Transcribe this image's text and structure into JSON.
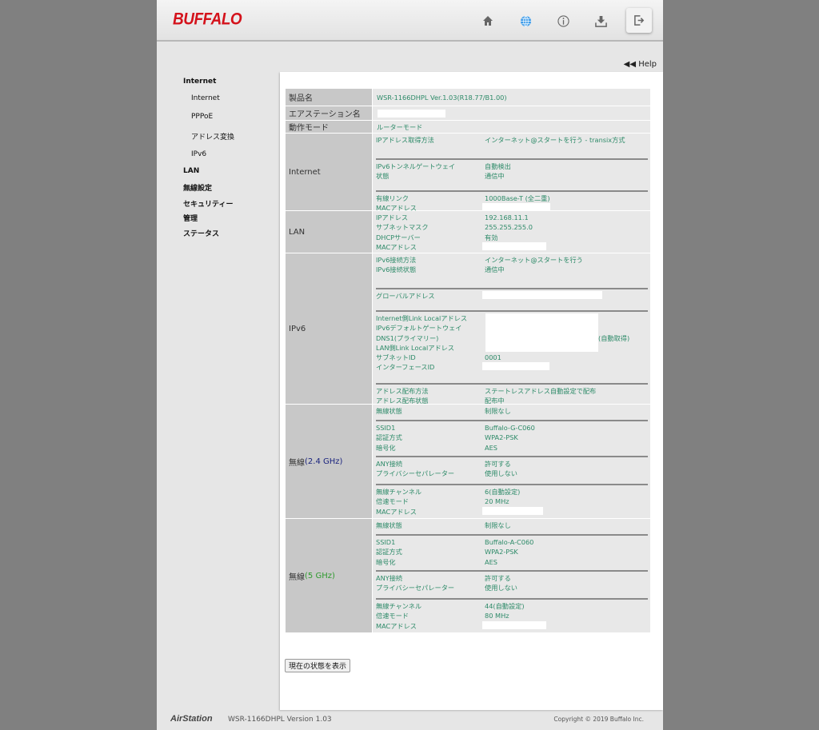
{
  "header": {
    "logo": "BUFFALO",
    "icons": [
      "home-icon",
      "globe-icon",
      "info-icon",
      "download-icon",
      "logout-icon"
    ]
  },
  "help": "◀◀ Help",
  "sidebar": [
    {
      "label": "Internet",
      "level": 0
    },
    {
      "label": "Internet",
      "level": 1
    },
    {
      "label": "PPPoE",
      "level": 1
    },
    {
      "label": "アドレス変換",
      "level": 1
    },
    {
      "label": "IPv6",
      "level": 1
    },
    {
      "label": "LAN",
      "level": 0
    },
    {
      "label": "無線設定",
      "level": 0
    },
    {
      "label": "セキュリティー",
      "level": 0
    },
    {
      "label": "管理",
      "level": 0
    },
    {
      "label": "ステータス",
      "level": 0
    }
  ],
  "top_rows": [
    {
      "label": "製品名",
      "value": "WSR-1166DHPL Ver.1.03(R18.77/B1.00)"
    },
    {
      "label": "エアステーション名",
      "value": "",
      "redacted": true
    },
    {
      "label": "動作モード",
      "value": "ルーターモード"
    }
  ],
  "sections": [
    {
      "label": "Internet",
      "groups": [
        [
          {
            "label": "IPアドレス取得方法",
            "value": "インターネット@スタートを行う - transix方式"
          }
        ],
        [
          {
            "label": "IPv6トンネルゲートウェイ",
            "value": "自動検出"
          },
          {
            "label": "状態",
            "value": "通信中"
          }
        ],
        [
          {
            "label": "有線リンク",
            "value": "1000Base-T (全二重)"
          },
          {
            "label": "MACアドレス",
            "redacted": true
          }
        ]
      ]
    },
    {
      "label": "LAN",
      "groups": [
        [
          {
            "label": "IPアドレス",
            "value": "192.168.11.1"
          },
          {
            "label": "サブネットマスク",
            "value": "255.255.255.0"
          },
          {
            "label": "DHCPサーバー",
            "value": "有効"
          },
          {
            "label": "MACアドレス",
            "redacted": true
          }
        ]
      ]
    },
    {
      "label": "IPv6",
      "groups": [
        [
          {
            "label": "IPv6接続方法",
            "value": "インターネット@スタートを行う"
          },
          {
            "label": "IPv6接続状態",
            "value": "通信中"
          }
        ],
        [
          {
            "label": "グローバルアドレス",
            "redacted": true
          }
        ],
        [
          {
            "label": "Internet側Link Localアドレス",
            "block": true
          },
          {
            "label": "IPv6デフォルトゲートウェイ",
            "block": true
          },
          {
            "label": "DNS1(プライマリー)",
            "block": true
          },
          {
            "label": "LAN側Link Localアドレス",
            "block": true
          },
          {
            "label": "サブネットID",
            "value": "0001"
          },
          {
            "label": "インターフェースID",
            "redacted": true
          }
        ],
        [
          {
            "label": "アドレス配布方法",
            "value": "ステートレスアドレス自動設定で配布"
          },
          {
            "label": "アドレス配布状態",
            "value": "配布中"
          }
        ]
      ],
      "block_note": "(自動取得)"
    },
    {
      "label": "無線",
      "band": "(2.4 GHz)",
      "band_color": "#1a237e",
      "groups": [
        [
          {
            "label": "無線状態",
            "value": "制限なし"
          }
        ],
        [
          {
            "label": "SSID1",
            "value": "Buffalo-G-C060"
          },
          {
            "label": "認証方式",
            "value": "WPA2-PSK"
          },
          {
            "label": "暗号化",
            "value": "AES"
          }
        ],
        [
          {
            "label": "ANY接続",
            "value": "許可する"
          },
          {
            "label": "プライバシーセパレーター",
            "value": "使用しない"
          }
        ],
        [
          {
            "label": "無線チャンネル",
            "value": "6(自動設定)"
          },
          {
            "label": "倍速モード",
            "value": "20 MHz"
          },
          {
            "label": "MACアドレス",
            "redacted": true
          }
        ]
      ]
    },
    {
      "label": "無線",
      "band": "(5 GHz)",
      "band_color": "#2e9a2e",
      "groups": [
        [
          {
            "label": "無線状態",
            "value": "制限なし"
          }
        ],
        [
          {
            "label": "SSID1",
            "value": "Buffalo-A-C060"
          },
          {
            "label": "認証方式",
            "value": "WPA2-PSK"
          },
          {
            "label": "暗号化",
            "value": "AES"
          }
        ],
        [
          {
            "label": "ANY接続",
            "value": "許可する"
          },
          {
            "label": "プライバシーセパレーター",
            "value": "使用しない"
          }
        ],
        [
          {
            "label": "無線チャンネル",
            "value": "44(自動設定)"
          },
          {
            "label": "倍速モード",
            "value": "80 MHz"
          },
          {
            "label": "MACアドレス",
            "redacted": true
          }
        ]
      ]
    }
  ],
  "button": "現在の状態を表示",
  "footer": {
    "brand": "AirStation",
    "version": "WSR-1166DHPL Version 1.03",
    "copyright": "Copyright © 2019 Buffalo Inc."
  }
}
